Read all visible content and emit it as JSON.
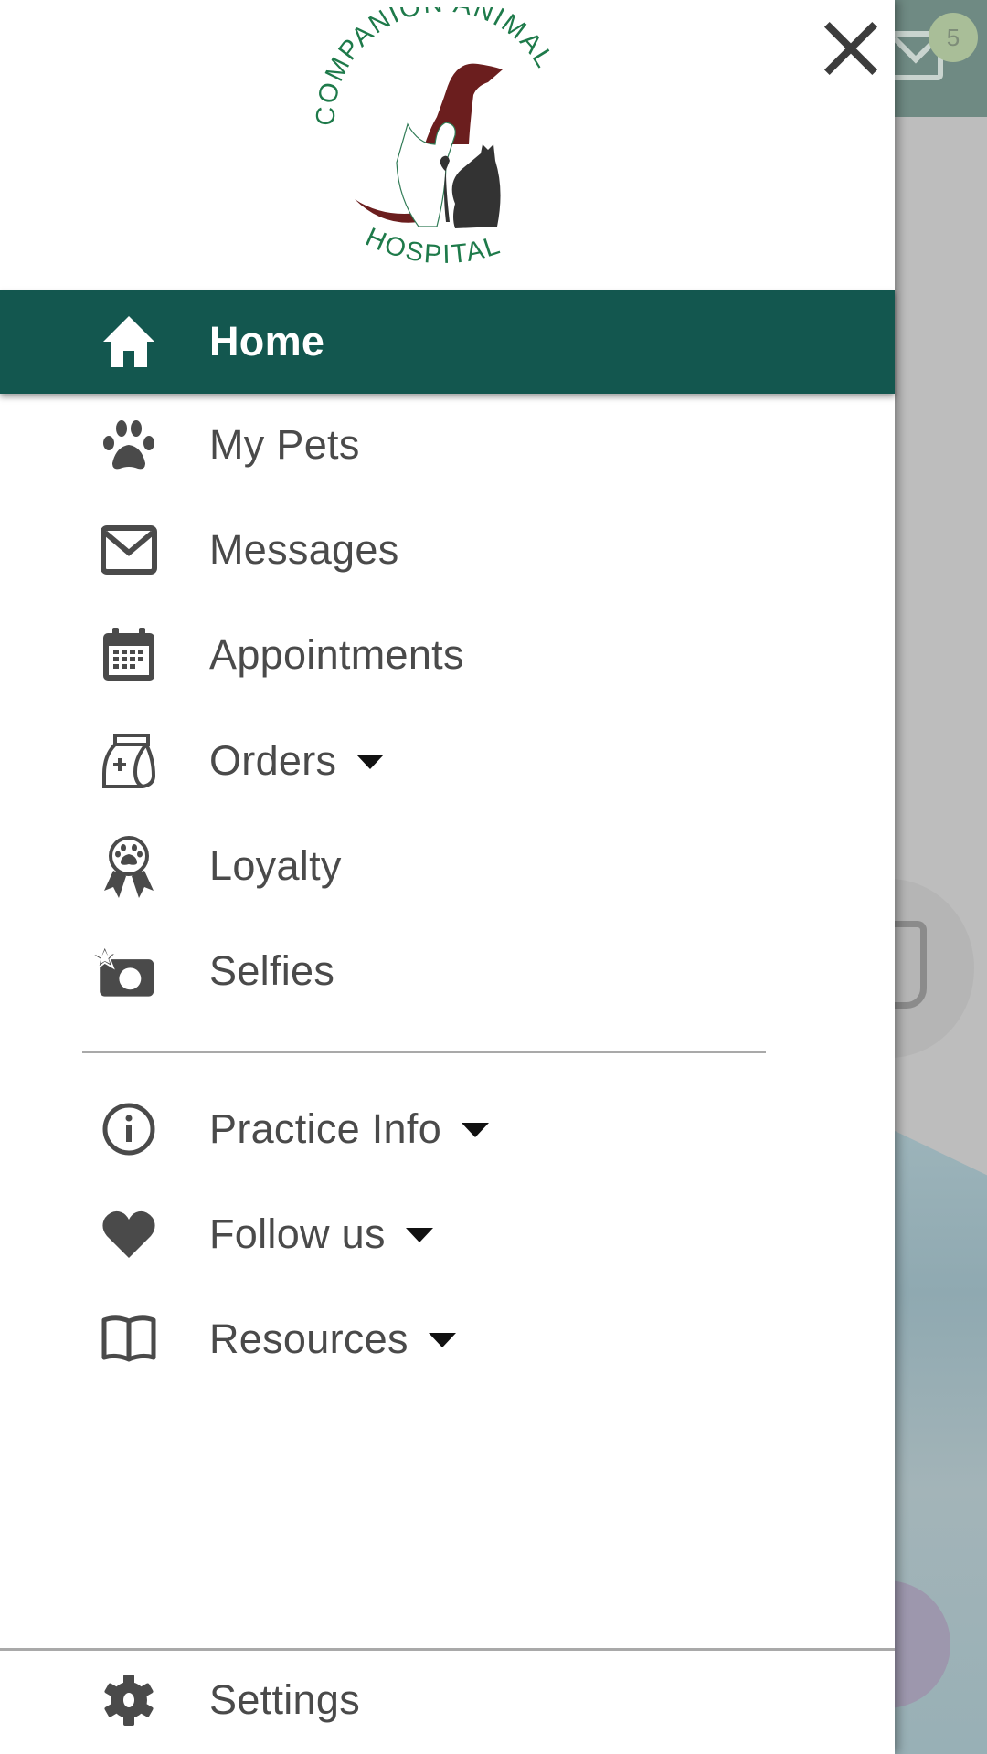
{
  "background": {
    "header_color": "#6f8a83",
    "mail_badge_count": "5"
  },
  "drawer": {
    "logo": {
      "top_text": "COMPANION ANIMAL",
      "bottom_text": "HOSPITAL",
      "text_color": "#1e7a4a",
      "dog_color": "#6b1e1e",
      "cat_color": "#333333"
    },
    "close_icon": "close-icon",
    "accent_color": "#13574f",
    "items": [
      {
        "label": "Home",
        "icon": "home-icon",
        "active": true,
        "expandable": false
      },
      {
        "label": "My Pets",
        "icon": "paw-icon",
        "active": false,
        "expandable": false
      },
      {
        "label": "Messages",
        "icon": "envelope-icon",
        "active": false,
        "expandable": false
      },
      {
        "label": "Appointments",
        "icon": "calendar-icon",
        "active": false,
        "expandable": false
      },
      {
        "label": "Orders",
        "icon": "medicine-bag-icon",
        "active": false,
        "expandable": true
      },
      {
        "label": "Loyalty",
        "icon": "award-ribbon-icon",
        "active": false,
        "expandable": false
      },
      {
        "label": "Selfies",
        "icon": "camera-star-icon",
        "active": false,
        "expandable": false
      }
    ],
    "secondary_items": [
      {
        "label": "Practice Info",
        "icon": "info-icon",
        "expandable": true
      },
      {
        "label": "Follow us",
        "icon": "heart-icon",
        "expandable": true
      },
      {
        "label": "Resources",
        "icon": "book-icon",
        "expandable": true
      }
    ],
    "footer": {
      "label": "Settings",
      "icon": "gear-icon"
    }
  }
}
